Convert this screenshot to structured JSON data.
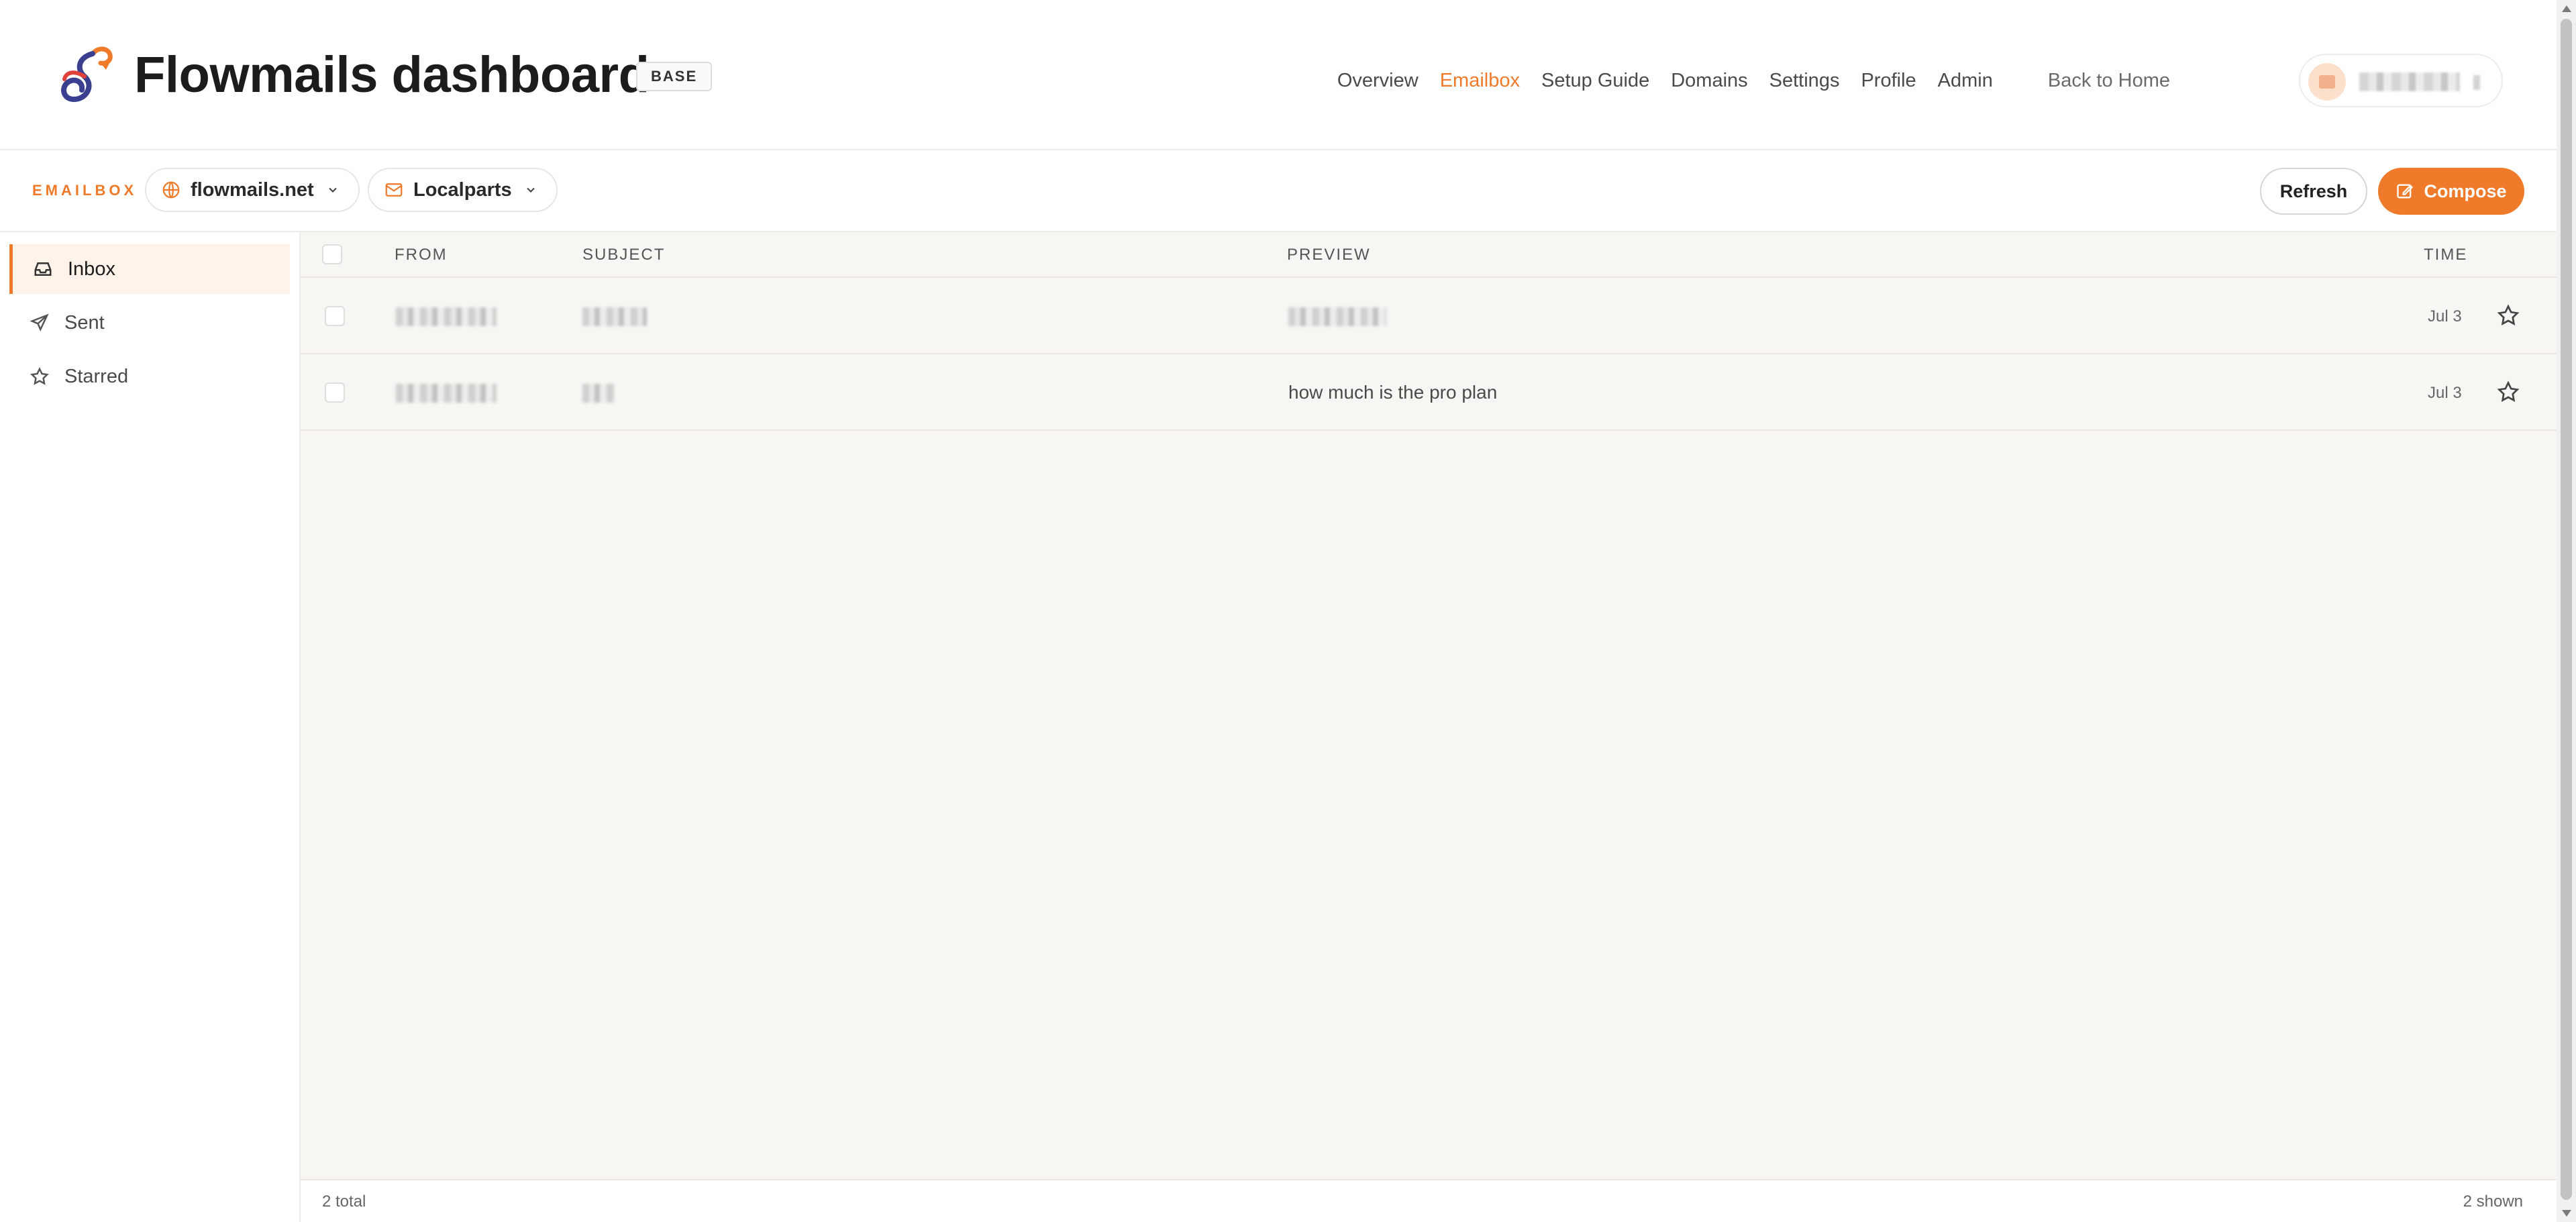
{
  "header": {
    "title": "Flowmails dashboard",
    "tier_badge": "BASE",
    "nav": [
      {
        "label": "Overview",
        "active": false
      },
      {
        "label": "Emailbox",
        "active": true
      },
      {
        "label": "Setup Guide",
        "active": false
      },
      {
        "label": "Domains",
        "active": false
      },
      {
        "label": "Settings",
        "active": false
      },
      {
        "label": "Profile",
        "active": false
      },
      {
        "label": "Admin",
        "active": false
      }
    ],
    "back_home": "Back to Home",
    "user_menu": {
      "avatar_icon": "folder-icon"
    }
  },
  "toolbar": {
    "section_label": "EMAILBOX",
    "domain_select": {
      "value": "flowmails.net",
      "icon": "globe-icon"
    },
    "localparts_select": {
      "value": "Localparts",
      "icon": "mail-icon"
    },
    "refresh_label": "Refresh",
    "compose_label": "Compose",
    "accent": "#ee7a2a"
  },
  "sidebar": {
    "items": [
      {
        "label": "Inbox",
        "icon": "inbox-icon",
        "active": true
      },
      {
        "label": "Sent",
        "icon": "send-icon",
        "active": false
      },
      {
        "label": "Starred",
        "icon": "star-icon",
        "active": false
      }
    ]
  },
  "mail_list": {
    "columns": {
      "from": "FROM",
      "subject": "SUBJECT",
      "preview": "PREVIEW",
      "time": "TIME"
    },
    "rows": [
      {
        "preview": "",
        "time": "Jul 3",
        "starred": false
      },
      {
        "preview": "how much is the pro plan",
        "time": "Jul 3",
        "starred": false
      }
    ],
    "footer_total": "2 total",
    "footer_shown": "2 shown"
  }
}
